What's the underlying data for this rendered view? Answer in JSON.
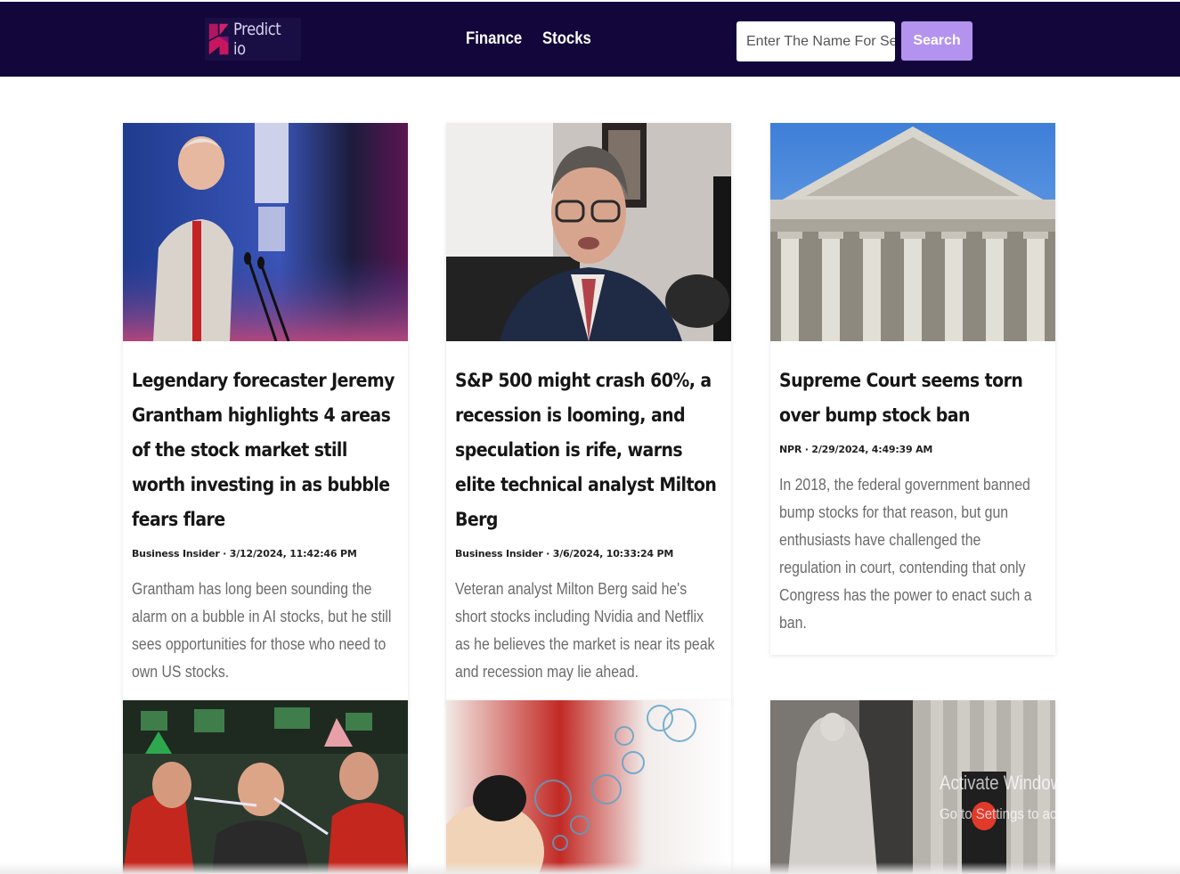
{
  "header": {
    "logo_text": "Predict io",
    "nav": [
      "Finance",
      "Stocks"
    ],
    "search": {
      "placeholder": "Enter The Name For Search",
      "value": ""
    },
    "search_button_label": "Search"
  },
  "articles": [
    {
      "title": "Legendary forecaster Jeremy Grantham highlights 4 areas of the stock market still worth investing in as bubble fears flare",
      "meta": "Business Insider · 3/12/2024, 11:42:46 PM",
      "description": "Grantham has long been sounding the alarm on a bubble in AI stocks, but he still sees opportunities for those who need to own US stocks."
    },
    {
      "title": "S&P 500 might crash 60%, a recession is looming, and speculation is rife, warns elite technical analyst Milton Berg",
      "meta": "Business Insider · 3/6/2024, 10:33:24 PM",
      "description": "Veteran analyst Milton Berg said he's short stocks including Nvidia and Netflix as he believes the market is near its peak and recession may lie ahead."
    },
    {
      "title": "Supreme Court seems torn over bump stock ban",
      "meta": "NPR · 2/29/2024, 4:49:39 AM",
      "description": "In 2018, the federal government banned bump stocks for that reason, but gun enthusiasts have challenged the regulation in court, contending that only Congress has the power to enact such a ban."
    }
  ],
  "os_watermark": {
    "title": "Activate Windows",
    "subtitle": "Go to Settings to activate Windows."
  },
  "colors": {
    "header_bg": "#12063a",
    "search_button": "#b493ee",
    "logo_accent": "#c4175f"
  }
}
